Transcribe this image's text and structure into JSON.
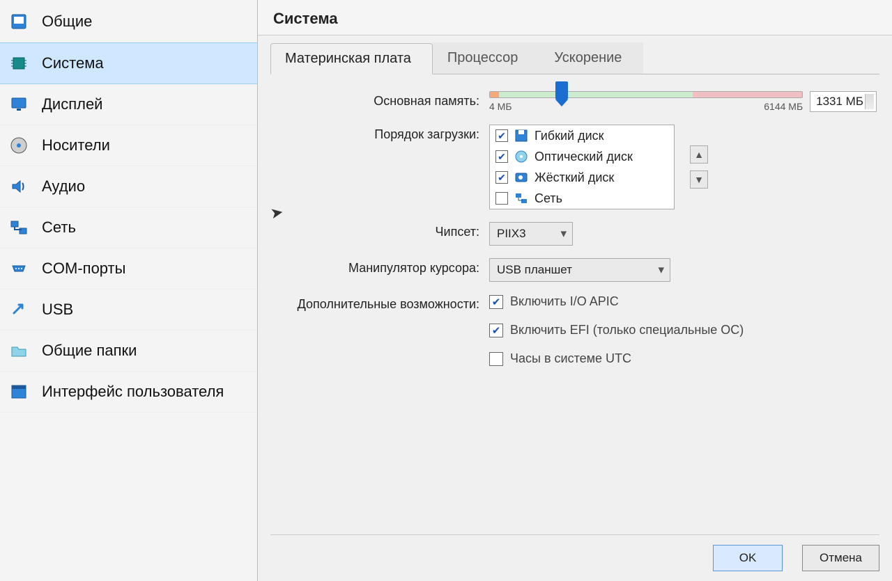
{
  "sidebar": {
    "items": [
      {
        "label": "Общие"
      },
      {
        "label": "Система"
      },
      {
        "label": "Дисплей"
      },
      {
        "label": "Носители"
      },
      {
        "label": "Аудио"
      },
      {
        "label": "Сеть"
      },
      {
        "label": "COM-порты"
      },
      {
        "label": "USB"
      },
      {
        "label": "Общие папки"
      },
      {
        "label": "Интерфейс пользователя"
      }
    ],
    "active_index": 1
  },
  "page": {
    "title": "Система"
  },
  "tabs": {
    "items": [
      "Материнская плата",
      "Процессор",
      "Ускорение"
    ],
    "active_index": 0
  },
  "memory": {
    "label": "Основная память:",
    "min_label": "4 МБ",
    "max_label": "6144 МБ",
    "value_text": "1331 МБ"
  },
  "boot": {
    "label": "Порядок загрузки:",
    "items": [
      {
        "checked": true,
        "label": "Гибкий диск"
      },
      {
        "checked": true,
        "label": "Оптический диск"
      },
      {
        "checked": true,
        "label": "Жёсткий диск"
      },
      {
        "checked": false,
        "label": "Сеть"
      }
    ]
  },
  "chipset": {
    "label": "Чипсет:",
    "value": "PIIX3"
  },
  "pointing": {
    "label": "Манипулятор курсора:",
    "value": "USB планшет"
  },
  "extended": {
    "label": "Дополнительные возможности:",
    "opts": [
      {
        "checked": true,
        "label": "Включить I/O APIC"
      },
      {
        "checked": true,
        "label": "Включить EFI (только специальные ОС)"
      },
      {
        "checked": false,
        "label": "Часы в системе UTC"
      }
    ]
  },
  "buttons": {
    "ok": "OK",
    "cancel": "Отмена"
  }
}
